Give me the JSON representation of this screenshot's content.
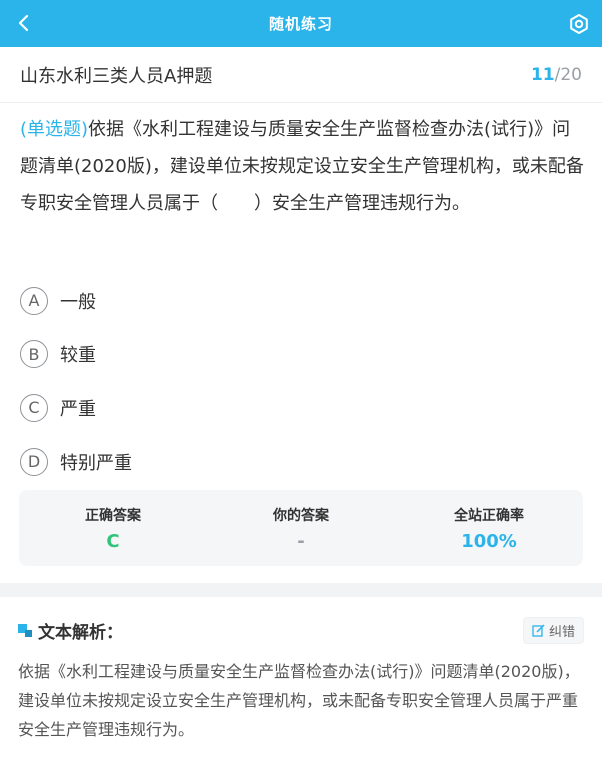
{
  "nav": {
    "title": "随机练习",
    "back_icon": "chevron-left-icon",
    "settings_icon": "gear-icon",
    "bar_color": "#2bb4ea"
  },
  "exam": {
    "title": "山东水利三类人员A押题",
    "current": "11",
    "separator": "/",
    "total": "20"
  },
  "question": {
    "type": "(单选题)",
    "text": "依据《水利工程建设与质量安全生产监督检查办法(试行)》问题清单(2020版)，建设单位未按规定设立安全生产管理机构，或未配备专职安全管理人员属于（　　）安全生产管理违规行为。"
  },
  "options": [
    {
      "letter": "A",
      "text": "一般"
    },
    {
      "letter": "B",
      "text": "较重"
    },
    {
      "letter": "C",
      "text": "严重"
    },
    {
      "letter": "D",
      "text": "特别严重"
    }
  ],
  "answers": {
    "correct_label": "正确答案",
    "correct_value": "C",
    "yours_label": "你的答案",
    "yours_value": "-",
    "rate_label": "全站正确率",
    "rate_value": "100%",
    "correct_color": "#2ec47a",
    "rate_color": "#2bb4ea"
  },
  "analysis": {
    "title": "文本解析：",
    "report_label": "纠错",
    "report_icon": "edit-icon",
    "body": "依据《水利工程建设与质量安全生产监督检查办法(试行)》问题清单(2020版)，建设单位未按规定设立安全生产管理机构，或未配备专职安全管理人员属于严重安全生产管理违规行为。"
  }
}
